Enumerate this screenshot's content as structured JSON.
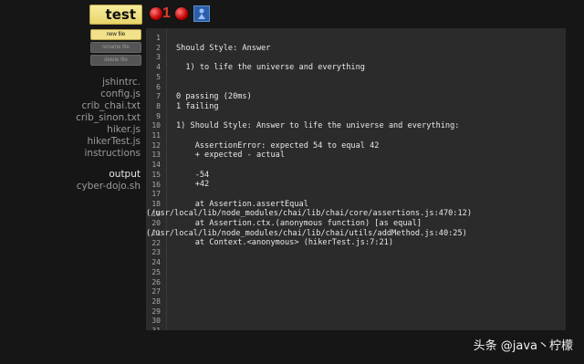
{
  "toolbar": {
    "test_label": "test",
    "traffic_light_count": "1"
  },
  "sidebar": {
    "buttons": {
      "new_file": "new file",
      "rename_file": "rename file",
      "delete_file": "delete file"
    },
    "files": [
      "jshintrc.",
      "config.js",
      "crib_chai.txt",
      "crib_sinon.txt",
      "hiker.js",
      "hikerTest.js",
      "instructions"
    ],
    "output": "output",
    "script": "cyber-dojo.sh"
  },
  "editor": {
    "lines": [
      "",
      "Should Style: Answer",
      "",
      "  1) to life the universe and everything",
      "",
      "",
      "0 passing (20ms)",
      "1 failing",
      "",
      "1) Should Style: Answer to life the universe and everything:",
      "",
      "    AssertionError: expected 54 to equal 42",
      "    + expected - actual",
      "",
      "    -54",
      "    +42",
      "",
      "    at Assertion.assertEqual",
      "(/usr/local/lib/node_modules/chai/lib/chai/core/assertions.js:470:12)",
      "    at Assertion.ctx.(anonymous function) [as equal]",
      "(/usr/local/lib/node_modules/chai/lib/chai/utils/addMethod.js:40:25)",
      "    at Context.<anonymous> (hikerTest.js:7:21)",
      "",
      "",
      "",
      "",
      "",
      "",
      "",
      "",
      ""
    ],
    "line_count": 31
  },
  "watermark": "头条 @java丶柠檬"
}
